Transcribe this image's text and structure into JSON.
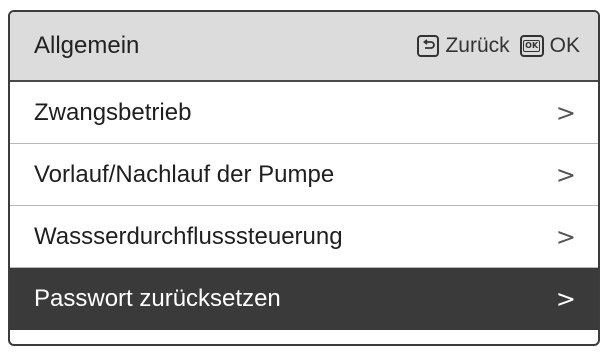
{
  "header": {
    "title": "Allgemein",
    "back_label": "Zurück",
    "ok_label": "OK",
    "ok_icon_text": "OK"
  },
  "menu": {
    "items": [
      {
        "label": "Zwangsbetrieb",
        "chevron": ">"
      },
      {
        "label": "Vorlauf/Nachlauf der Pumpe",
        "chevron": ">"
      },
      {
        "label": "Wassserdurchflusssteuerung",
        "chevron": ">"
      },
      {
        "label": "Passwort zurücksetzen",
        "chevron": ">",
        "selected": true
      }
    ]
  },
  "colors": {
    "header_bg": "#dcdcdc",
    "selected_bg": "#3a3a3a",
    "selected_text": "#ffffff"
  }
}
